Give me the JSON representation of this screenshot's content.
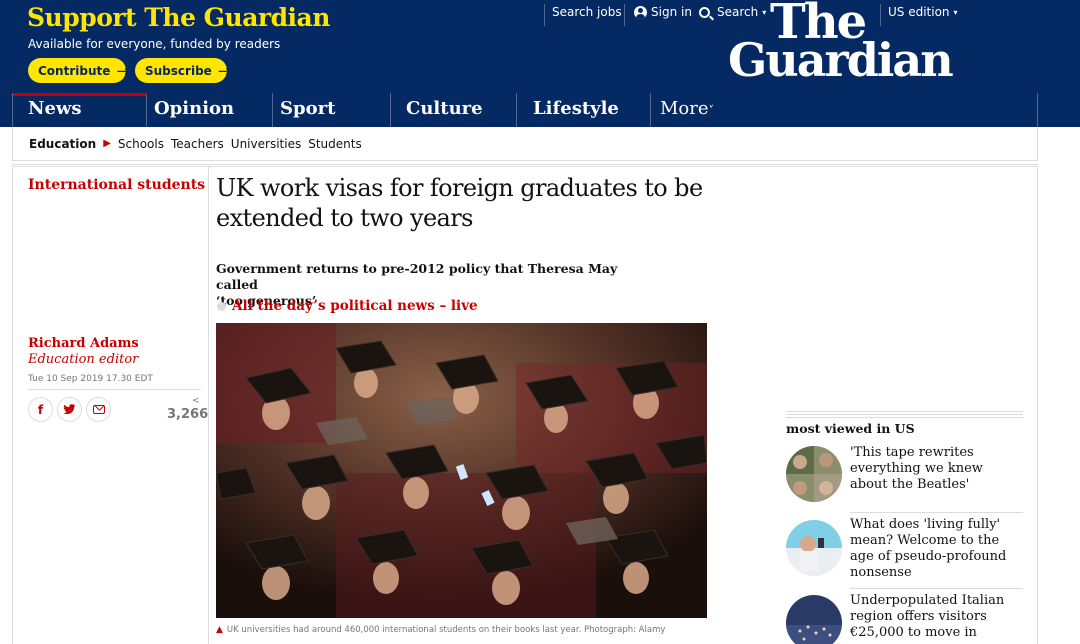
{
  "support": {
    "title": "Support The Guardian",
    "subtitle": "Available for everyone, funded by readers",
    "contribute_label": "Contribute",
    "subscribe_label": "Subscribe"
  },
  "toplinks": {
    "jobs": "Search jobs",
    "signin": "Sign in",
    "search": "Search",
    "edition": "US edition"
  },
  "logo": {
    "line1": "The",
    "line2": "Guardian"
  },
  "nav": {
    "items": [
      "News",
      "Opinion",
      "Sport",
      "Culture",
      "Lifestyle"
    ],
    "more": "More"
  },
  "subnav": {
    "section": "Education",
    "items": [
      "Schools",
      "Teachers",
      "Universities",
      "Students"
    ]
  },
  "article": {
    "kicker": "International students",
    "headline": "UK work visas for foreign graduates to be extended to two years",
    "standfirst_1": "Government returns to pre-2012 policy that Theresa May called",
    "standfirst_2": "‘too generous’",
    "live_link": "All the day’s political news – live",
    "author": "Richard Adams",
    "author_role": "Education editor",
    "date": "Tue 10 Sep 2019 17.30 EDT",
    "share_count": "3,266",
    "caption": "UK universities had around 460,000 international students on their books last year. Photograph: Alamy"
  },
  "most_viewed": {
    "title": "most viewed in US",
    "items": [
      "'This tape rewrites everything we knew about the Beatles'",
      "What does 'living fully' mean? Welcome to the age of pseudo-profound nonsense",
      "Underpopulated Italian region offers visitors €25,000 to move in"
    ]
  },
  "colors": {
    "brand_blue": "#052962",
    "support_yellow": "#ffe500",
    "news_red": "#c70000"
  },
  "icons": [
    "avatar-icon",
    "search-icon",
    "facebook-icon",
    "twitter-icon",
    "email-icon",
    "share-icon",
    "caption-triangle-icon"
  ]
}
